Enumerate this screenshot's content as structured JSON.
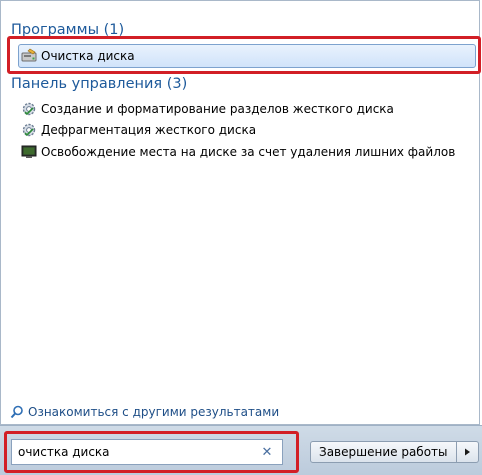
{
  "programs": {
    "heading": "Программы (1)",
    "items": [
      {
        "label": "Очистка диска",
        "icon": "disk-cleanup-icon"
      }
    ]
  },
  "control_panel": {
    "heading": "Панель управления (3)",
    "items": [
      {
        "label": "Создание и форматирование разделов жесткого диска",
        "icon": "control-panel-gear-icon"
      },
      {
        "label": "Дефрагментация жесткого диска",
        "icon": "control-panel-gear-icon"
      },
      {
        "label": "Освобождение места на диске за счет удаления лишних файлов",
        "icon": "monitor-icon"
      }
    ]
  },
  "more_results": {
    "label": "Ознакомиться с другими результатами",
    "icon": "search-icon"
  },
  "search": {
    "value": "очистка диска",
    "clear_icon": "clear-icon"
  },
  "shutdown": {
    "label": "Завершение работы",
    "arrow_icon": "triangle-right-icon"
  },
  "colors": {
    "heading": "#1e5a9b",
    "highlight_border": "#d21f26",
    "selection": "#d0e3fa"
  }
}
